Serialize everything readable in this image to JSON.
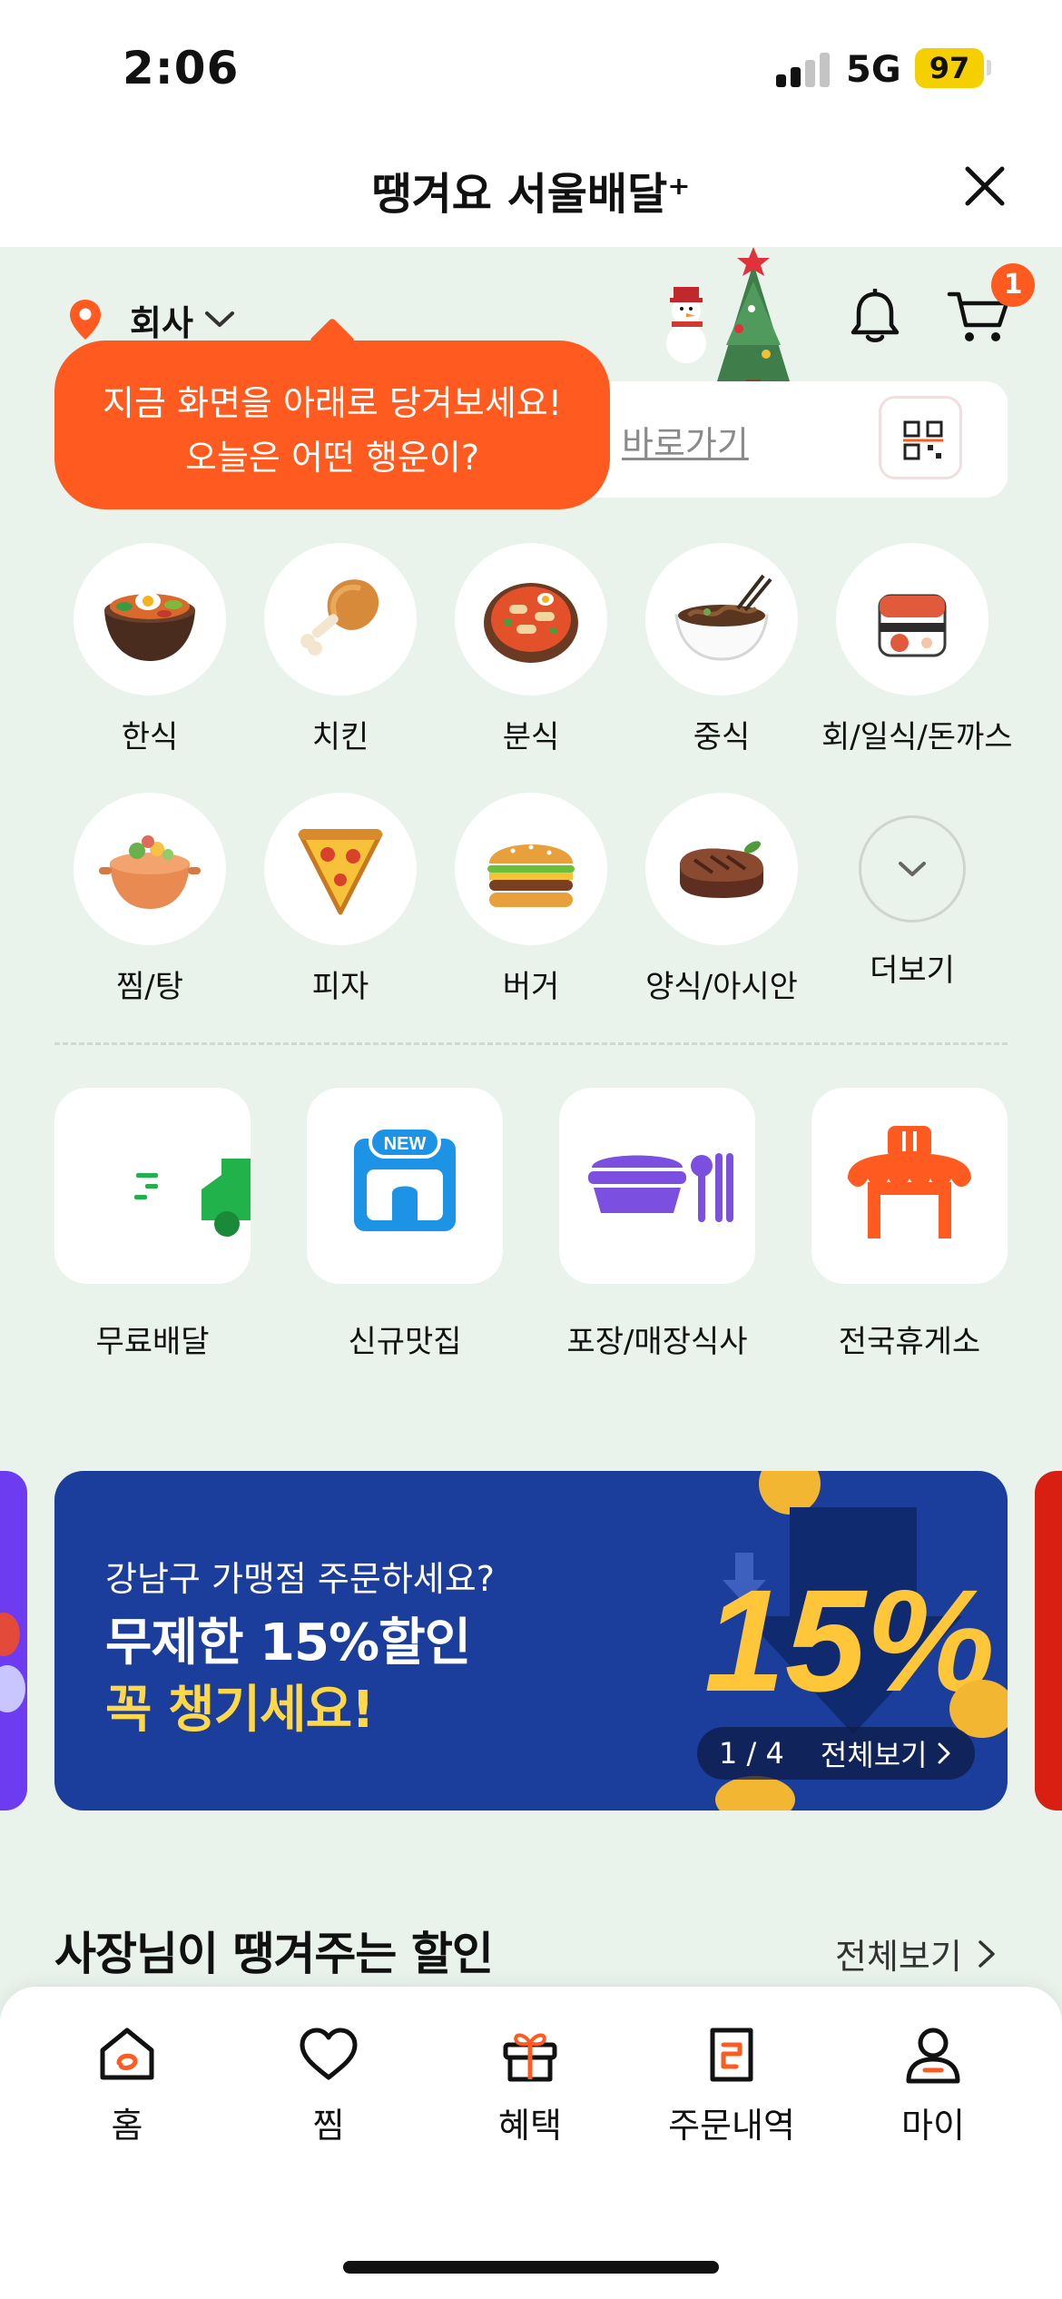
{
  "status_bar": {
    "time": "2:06",
    "network": "5G",
    "battery": "97"
  },
  "header": {
    "title": "땡겨요 서울배달⁺"
  },
  "location": {
    "label": "회사"
  },
  "cart": {
    "badge": "1"
  },
  "tooltip": {
    "line1": "지금 화면을 아래로 당겨보세요!",
    "line2": "오늘은 어떤 행운이?"
  },
  "search": {
    "shortcut_label": "바로가기"
  },
  "categories": [
    {
      "label": "한식",
      "icon": "bibimbap-icon"
    },
    {
      "label": "치킨",
      "icon": "chicken-icon"
    },
    {
      "label": "분식",
      "icon": "tteokbokki-icon"
    },
    {
      "label": "중식",
      "icon": "noodles-icon"
    },
    {
      "label": "회/일식/돈까스",
      "icon": "sushi-icon"
    },
    {
      "label": "찜/탕",
      "icon": "stew-icon"
    },
    {
      "label": "피자",
      "icon": "pizza-icon"
    },
    {
      "label": "버거",
      "icon": "burger-icon"
    },
    {
      "label": "양식/아시안",
      "icon": "steak-icon"
    },
    {
      "label": "더보기",
      "icon": "chevron-down-icon"
    }
  ],
  "services": [
    {
      "label": "무료배달",
      "icon": "delivery-truck-icon"
    },
    {
      "label": "신규맛집",
      "icon": "new-store-icon"
    },
    {
      "label": "포장/매장식사",
      "icon": "takeout-icon"
    },
    {
      "label": "전국휴게소",
      "icon": "rest-area-icon"
    }
  ],
  "banner": {
    "subtitle": "강남구 가맹점 주문하세요?",
    "headline1": "무제한 15%할인",
    "headline2": "꼭 챙기세요!",
    "counter": "1 / 4",
    "view_all": "전체보기",
    "art_text": "15%"
  },
  "section": {
    "title": "사장님이 땡겨주는 할인",
    "view_all": "전체보기"
  },
  "nav": [
    {
      "label": "홈",
      "icon": "home-icon"
    },
    {
      "label": "찜",
      "icon": "heart-icon"
    },
    {
      "label": "혜택",
      "icon": "gift-icon"
    },
    {
      "label": "주문내역",
      "icon": "order-list-icon"
    },
    {
      "label": "마이",
      "icon": "person-icon"
    }
  ],
  "colors": {
    "accent": "#FF5A1F",
    "background": "#E9F3EC",
    "banner": "#1B3D9B",
    "highlight": "#FFD84A"
  }
}
